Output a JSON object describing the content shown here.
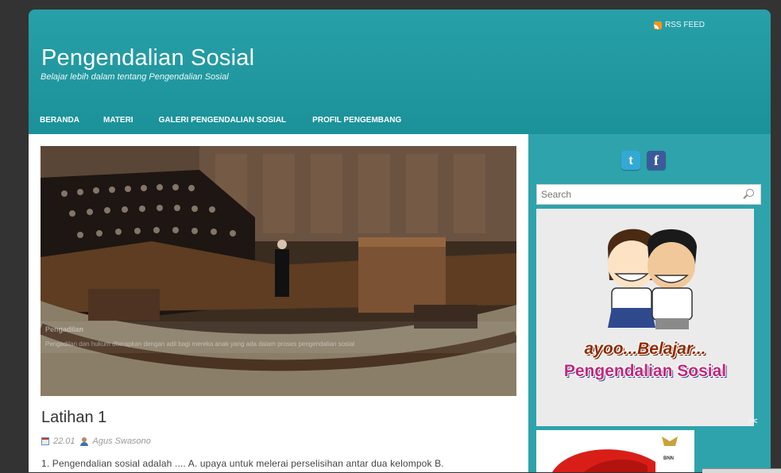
{
  "header": {
    "rss_label": "RSS FEED",
    "site_title": "Pengendalian Sosial",
    "tagline": "Belajar lebih dalam tentang Pengendalian Sosial"
  },
  "nav": {
    "items": [
      "BERANDA",
      "MATERI",
      "GALERI PENGENDALIAN SOSIAL",
      "PROFIL PENGEMBANG"
    ]
  },
  "slider": {
    "caption_title": "Pengadilan",
    "caption_text": "Pengadilan dan hukum diterapkan dengan adil bagi mereka anak yang ada dalam proses pengendalian sosial"
  },
  "post": {
    "title": "Latihan 1",
    "time": "22.01",
    "author": "Agus Swasono",
    "excerpt": "1. Pengendalian sosial adalah .... A. upaya untuk melerai perselisihan antar dua kelompok B."
  },
  "sidebar": {
    "social_icons": [
      "twitter-icon",
      "facebook-icon"
    ],
    "twitter_glyph": "t",
    "facebook_glyph": "f",
    "search_placeholder": "Search",
    "banner_line1": "ayoo...Belajar...",
    "banner_line2": "Pengendalian Sosial",
    "banner2_label": "BNN"
  },
  "colors": {
    "header_bg": "#1b9199",
    "page_bg": "#2ea3ab",
    "outer_bg": "#333333",
    "rss_accent": "#f7941d"
  }
}
